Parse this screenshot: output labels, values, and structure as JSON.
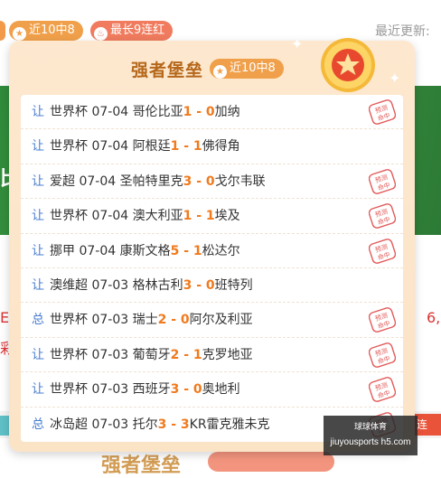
{
  "header": {
    "pill_recent": "近10中8",
    "pill_streak": "最长9连红",
    "latest_label": "最近更新:"
  },
  "background": {
    "banner_text": "比",
    "side_left": "E /",
    "side_left2": "彩",
    "side_right": "6,",
    "strip_right": "连",
    "bottom_title": "强者堡垒"
  },
  "card": {
    "title": "强者堡垒",
    "badge": "近10中8",
    "stamp_text": "预测命中",
    "matches": [
      {
        "kind": "让",
        "league": "世界杯",
        "date": "07-04",
        "home": "哥伦比亚",
        "score": "1 - 0",
        "away": "加纳",
        "hit": true
      },
      {
        "kind": "让",
        "league": "世界杯",
        "date": "07-04",
        "home": "阿根廷",
        "score": "1 - 1",
        "away": "佛得角",
        "hit": false
      },
      {
        "kind": "让",
        "league": "爱超",
        "date": "07-04",
        "home": "圣帕特里克",
        "score": "3 - 0",
        "away": "戈尔韦联",
        "hit": true
      },
      {
        "kind": "让",
        "league": "世界杯",
        "date": "07-04",
        "home": "澳大利亚",
        "score": "1 - 1",
        "away": "埃及",
        "hit": true
      },
      {
        "kind": "让",
        "league": "挪甲",
        "date": "07-04",
        "home": "康斯文格",
        "score": "5 - 1",
        "away": "松达尔",
        "hit": true
      },
      {
        "kind": "让",
        "league": "澳维超",
        "date": "07-03",
        "home": "格林古利",
        "score": "3 - 0",
        "away": "班特列",
        "hit": false
      },
      {
        "kind": "总",
        "league": "世界杯",
        "date": "07-03",
        "home": "瑞士",
        "score": "2 - 0",
        "away": "阿尔及利亚",
        "hit": true
      },
      {
        "kind": "让",
        "league": "世界杯",
        "date": "07-03",
        "home": "葡萄牙",
        "score": "2 - 1",
        "away": "克罗地亚",
        "hit": true
      },
      {
        "kind": "让",
        "league": "世界杯",
        "date": "07-03",
        "home": "西班牙",
        "score": "3 - 0",
        "away": "奥地利",
        "hit": true
      },
      {
        "kind": "总",
        "league": "冰岛超",
        "date": "07-03",
        "home": "托尔",
        "score": "3 - 3",
        "away": "KR雷克雅未克",
        "hit": true
      }
    ]
  },
  "watermark": {
    "line1": "球球体育",
    "line2": "jiuyousports h5.com"
  },
  "colors": {
    "accent_orange": "#f07a1e",
    "kind_blue": "#4a7fd0",
    "title_brown": "#b5671a",
    "stamp_red": "#e35a5a"
  }
}
